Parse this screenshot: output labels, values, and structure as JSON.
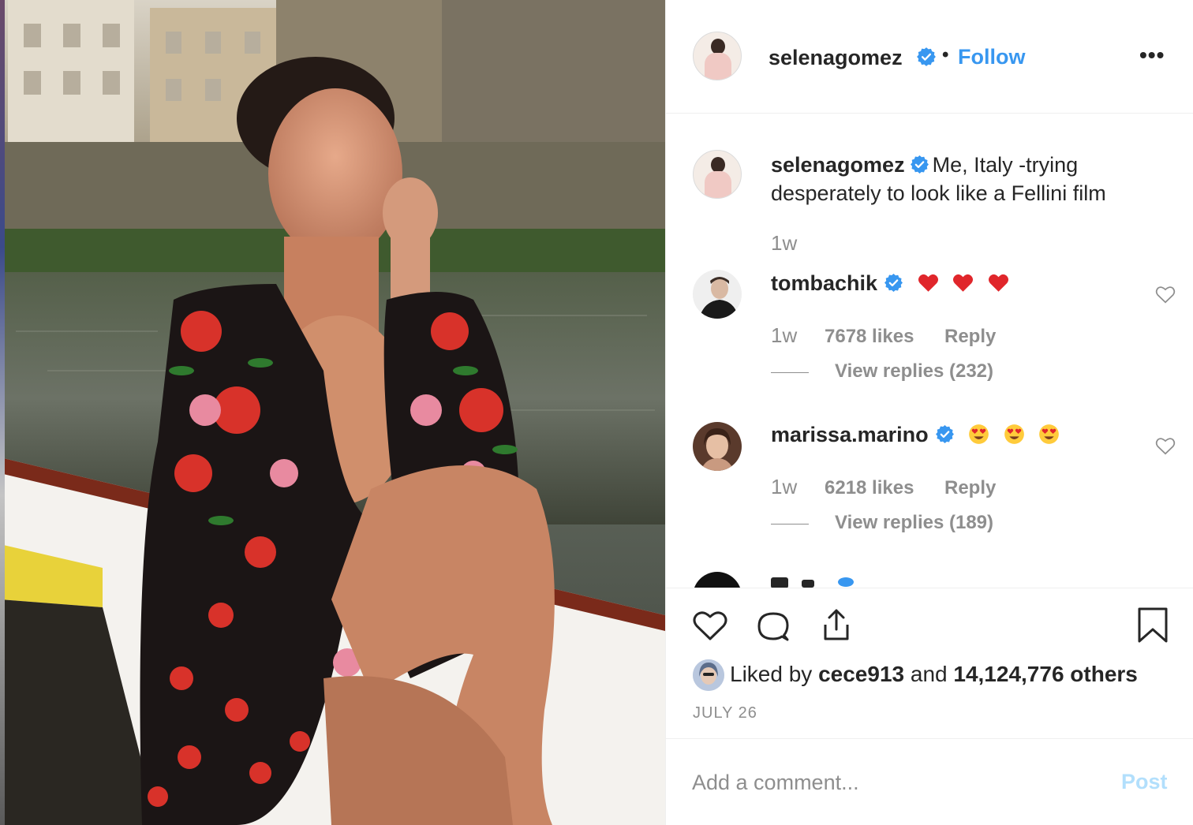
{
  "post": {
    "author": "selenagomez",
    "separator": "•",
    "follow_label": "Follow",
    "more_label": "•••"
  },
  "caption": {
    "username": "selenagomez",
    "text": "Me, Italy -trying desperately to look like a Fellini film",
    "time": "1w"
  },
  "comments": [
    {
      "username": "tombachik",
      "emoji": [
        "red-heart",
        "red-heart",
        "red-heart"
      ],
      "time": "1w",
      "likes": "7678 likes",
      "reply_label": "Reply",
      "view_replies": "View replies (232)"
    },
    {
      "username": "marissa.marino",
      "emoji": [
        "heart-eyes-face",
        "heart-eyes-face",
        "heart-eyes-face"
      ],
      "time": "1w",
      "likes": "6218 likes",
      "reply_label": "Reply",
      "view_replies": "View replies (189)"
    }
  ],
  "actions": {
    "icons": [
      "heart-icon",
      "comment-icon",
      "share-icon",
      "bookmark-icon"
    ],
    "liked_prefix": "Liked by",
    "liked_user": "cece913",
    "liked_and": "and",
    "liked_count": "14,124,776 others",
    "date": "JULY 26"
  },
  "add_comment": {
    "placeholder": "Add a comment...",
    "post_label": "Post"
  },
  "colors": {
    "link_blue": "#3897f0",
    "post_disabled": "#b2dffc",
    "muted": "#8e8e8e",
    "text": "#262626",
    "verified": "#3897f0"
  }
}
